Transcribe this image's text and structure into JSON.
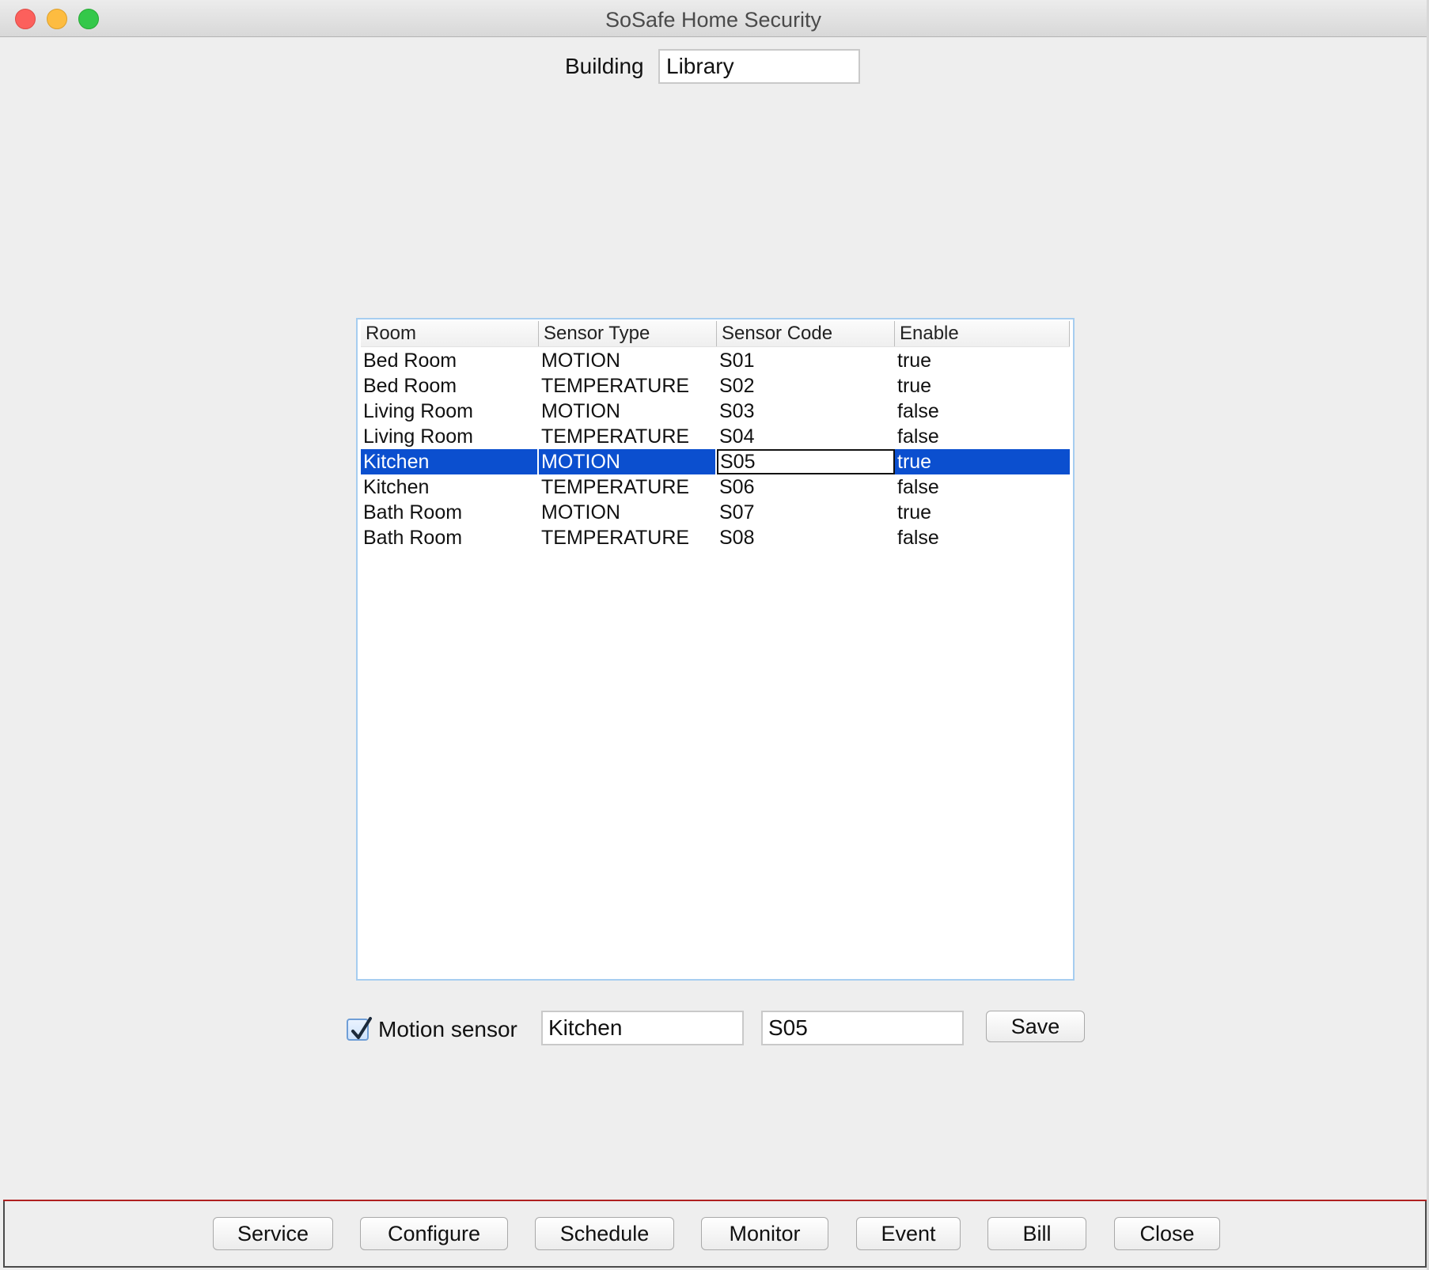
{
  "window": {
    "title": "SoSafe Home Security"
  },
  "building": {
    "label": "Building",
    "value": "Library"
  },
  "table": {
    "columns": [
      "Room",
      "Sensor Type",
      "Sensor Code",
      "Enable"
    ],
    "rows": [
      {
        "room": "Bed Room",
        "type": "MOTION",
        "code": "S01",
        "enable": "true"
      },
      {
        "room": "Bed Room",
        "type": "TEMPERATURE",
        "code": "S02",
        "enable": "true"
      },
      {
        "room": "Living Room",
        "type": "MOTION",
        "code": "S03",
        "enable": "false"
      },
      {
        "room": "Living Room",
        "type": "TEMPERATURE",
        "code": "S04",
        "enable": "false"
      },
      {
        "room": "Kitchen",
        "type": "MOTION",
        "code": "S05",
        "enable": "true"
      },
      {
        "room": "Kitchen",
        "type": "TEMPERATURE",
        "code": "S06",
        "enable": "false"
      },
      {
        "room": "Bath Room",
        "type": "MOTION",
        "code": "S07",
        "enable": "true"
      },
      {
        "room": "Bath Room",
        "type": "TEMPERATURE",
        "code": "S08",
        "enable": "false"
      }
    ],
    "selected_row_index": 4,
    "selection_color": "#0b4fcf"
  },
  "editor": {
    "motion_checkbox_label": "Motion sensor",
    "motion_checked": true,
    "room_value": "Kitchen",
    "code_value": "S05",
    "save_label": "Save"
  },
  "bottom_bar": {
    "buttons": [
      "Service",
      "Configure",
      "Schedule",
      "Monitor",
      "Event",
      "Bill",
      "Close"
    ],
    "accent_line_color": "#b02020"
  }
}
